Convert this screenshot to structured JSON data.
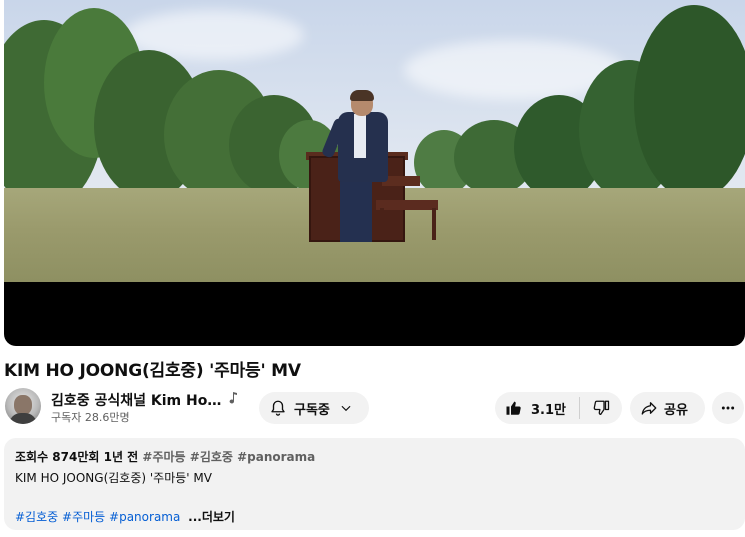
{
  "video": {
    "title": "KIM HO JOONG(김호중) '주마등' MV"
  },
  "channel": {
    "name": "김호중 공식채널 Kim Hoj...",
    "subscribers": "구독자 28.6만명",
    "badge_icon": "music-note-icon"
  },
  "actions": {
    "subscribe_label": "구독중",
    "like_count": "3.1만",
    "share_label": "공유"
  },
  "description": {
    "stats": "조회수 874만회  1년 전",
    "header_tags": "#주마등 #김호중 #panorama",
    "text": "KIM HO JOONG(김호중) '주마등' MV",
    "hashtags": [
      "#김호중",
      "#주마등",
      "#panorama"
    ],
    "more_label": "...더보기"
  },
  "colors": {
    "link": "#065fd4",
    "button_bg": "#f2f2f2",
    "text_secondary": "#606060"
  }
}
